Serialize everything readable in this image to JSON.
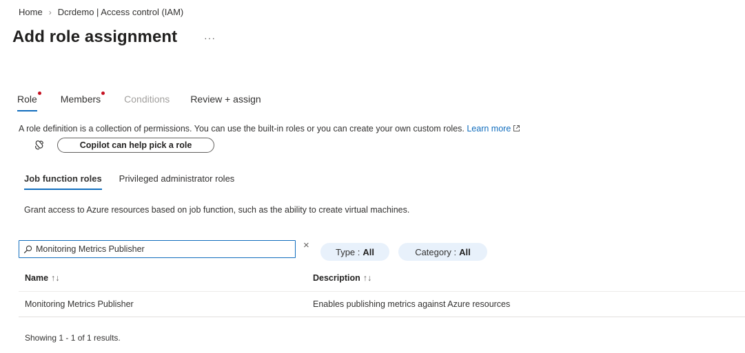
{
  "breadcrumb": {
    "home": "Home",
    "separator": "›",
    "current": "Dcrdemo | Access control (IAM)"
  },
  "page": {
    "title": "Add role assignment",
    "more": "···"
  },
  "tabs": [
    {
      "label": "Role",
      "required": true,
      "state": "active"
    },
    {
      "label": "Members",
      "required": true,
      "state": "normal"
    },
    {
      "label": "Conditions",
      "required": false,
      "state": "disabled"
    },
    {
      "label": "Review + assign",
      "required": false,
      "state": "normal"
    }
  ],
  "description": {
    "text": "A role definition is a collection of permissions. You can use the built-in roles or you can create your own custom roles.",
    "learn_more": "Learn more"
  },
  "copilot": {
    "button_label": "Copilot can help pick a role",
    "icon": "copilot-icon"
  },
  "subtabs": [
    {
      "label": "Job function roles",
      "state": "active"
    },
    {
      "label": "Privileged administrator roles",
      "state": "normal"
    }
  ],
  "grant_text": "Grant access to Azure resources based on job function, such as the ability to create virtual machines.",
  "search": {
    "value": "Monitoring Metrics Publisher",
    "clear": "×",
    "icon": "search-icon"
  },
  "filters": {
    "type": {
      "label": "Type :",
      "value": "All"
    },
    "category": {
      "label": "Category :",
      "value": "All"
    }
  },
  "table": {
    "columns": [
      {
        "label": "Name",
        "sort": "↑↓"
      },
      {
        "label": "Description",
        "sort": "↑↓"
      }
    ],
    "rows": [
      {
        "name": "Monitoring Metrics Publisher",
        "description": "Enables publishing metrics against Azure resources"
      }
    ]
  },
  "results_text": "Showing 1 - 1 of 1 results.",
  "colors": {
    "accent": "#0f6cbd",
    "required_dot": "#c50f1f",
    "pill_bg": "#e8f1fb"
  }
}
